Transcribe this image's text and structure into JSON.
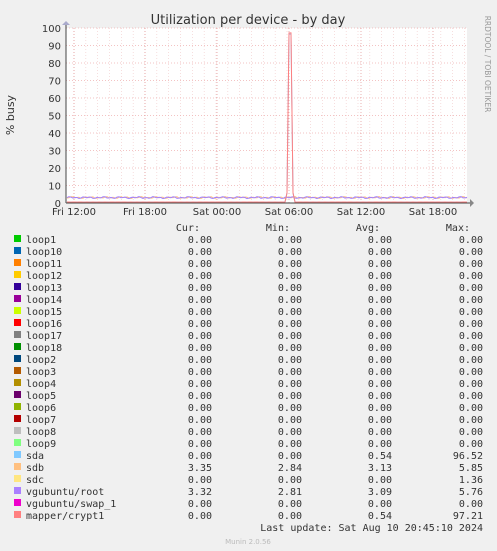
{
  "chart_data": {
    "type": "line",
    "title": "Utilization per device - by day",
    "ylabel": "% busy",
    "watermark": "RRDTOOL / TOBI OETIKER",
    "ylim": [
      0,
      100
    ],
    "yticks": [
      0,
      10,
      20,
      30,
      40,
      50,
      60,
      70,
      80,
      90,
      100
    ],
    "xticks": [
      "Fri 12:00",
      "Fri 18:00",
      "Sat 00:00",
      "Sat 06:00",
      "Sat 12:00",
      "Sat 18:00"
    ],
    "grid": true,
    "series": [
      {
        "name": "sdb",
        "color": "#ffc080",
        "level": 3.13,
        "spike": null
      },
      {
        "name": "vgubuntu/root",
        "color": "#a080ff",
        "level": 3.09,
        "spike": null
      },
      {
        "name": "sda",
        "color": "#80c0ff",
        "level": 0.54,
        "spike": 96.52
      },
      {
        "name": "mapper/crypt1",
        "color": "#ff8080",
        "level": 0.54,
        "spike": 97.21
      }
    ]
  },
  "legend": {
    "headers": {
      "cur": "Cur:",
      "min": "Min:",
      "avg": "Avg:",
      "max": "Max:"
    },
    "rows": [
      {
        "name": "loop1",
        "color": "#00cc00",
        "cur": "0.00",
        "min": "0.00",
        "avg": "0.00",
        "max": "0.00"
      },
      {
        "name": "loop10",
        "color": "#0066b3",
        "cur": "0.00",
        "min": "0.00",
        "avg": "0.00",
        "max": "0.00"
      },
      {
        "name": "loop11",
        "color": "#ff8000",
        "cur": "0.00",
        "min": "0.00",
        "avg": "0.00",
        "max": "0.00"
      },
      {
        "name": "loop12",
        "color": "#ffcc00",
        "cur": "0.00",
        "min": "0.00",
        "avg": "0.00",
        "max": "0.00"
      },
      {
        "name": "loop13",
        "color": "#330099",
        "cur": "0.00",
        "min": "0.00",
        "avg": "0.00",
        "max": "0.00"
      },
      {
        "name": "loop14",
        "color": "#990099",
        "cur": "0.00",
        "min": "0.00",
        "avg": "0.00",
        "max": "0.00"
      },
      {
        "name": "loop15",
        "color": "#ccff00",
        "cur": "0.00",
        "min": "0.00",
        "avg": "0.00",
        "max": "0.00"
      },
      {
        "name": "loop16",
        "color": "#ff0000",
        "cur": "0.00",
        "min": "0.00",
        "avg": "0.00",
        "max": "0.00"
      },
      {
        "name": "loop17",
        "color": "#808080",
        "cur": "0.00",
        "min": "0.00",
        "avg": "0.00",
        "max": "0.00"
      },
      {
        "name": "loop18",
        "color": "#008f00",
        "cur": "0.00",
        "min": "0.00",
        "avg": "0.00",
        "max": "0.00"
      },
      {
        "name": "loop2",
        "color": "#00487d",
        "cur": "0.00",
        "min": "0.00",
        "avg": "0.00",
        "max": "0.00"
      },
      {
        "name": "loop3",
        "color": "#b35a00",
        "cur": "0.00",
        "min": "0.00",
        "avg": "0.00",
        "max": "0.00"
      },
      {
        "name": "loop4",
        "color": "#b38f00",
        "cur": "0.00",
        "min": "0.00",
        "avg": "0.00",
        "max": "0.00"
      },
      {
        "name": "loop5",
        "color": "#6b006b",
        "cur": "0.00",
        "min": "0.00",
        "avg": "0.00",
        "max": "0.00"
      },
      {
        "name": "loop6",
        "color": "#8fb300",
        "cur": "0.00",
        "min": "0.00",
        "avg": "0.00",
        "max": "0.00"
      },
      {
        "name": "loop7",
        "color": "#b30000",
        "cur": "0.00",
        "min": "0.00",
        "avg": "0.00",
        "max": "0.00"
      },
      {
        "name": "loop8",
        "color": "#bebebe",
        "cur": "0.00",
        "min": "0.00",
        "avg": "0.00",
        "max": "0.00"
      },
      {
        "name": "loop9",
        "color": "#80ff80",
        "cur": "0.00",
        "min": "0.00",
        "avg": "0.00",
        "max": "0.00"
      },
      {
        "name": "sda",
        "color": "#80c9ff",
        "cur": "0.00",
        "min": "0.00",
        "avg": "0.54",
        "max": "96.52"
      },
      {
        "name": "sdb",
        "color": "#ffc080",
        "cur": "3.35",
        "min": "2.84",
        "avg": "3.13",
        "max": "5.85"
      },
      {
        "name": "sdc",
        "color": "#ffe680",
        "cur": "0.00",
        "min": "0.00",
        "avg": "0.00",
        "max": "1.36"
      },
      {
        "name": "vgubuntu/root",
        "color": "#aa80ff",
        "cur": "3.32",
        "min": "2.81",
        "avg": "3.09",
        "max": "5.76"
      },
      {
        "name": "vgubuntu/swap_1",
        "color": "#ee00cc",
        "cur": "0.00",
        "min": "0.00",
        "avg": "0.00",
        "max": "0.00"
      },
      {
        "name": "mapper/crypt1",
        "color": "#ff8080",
        "cur": "0.00",
        "min": "0.00",
        "avg": "0.54",
        "max": "97.21"
      }
    ]
  },
  "last_update": "Last update: Sat Aug 10 20:45:10 2024",
  "footer": "Munin 2.0.56"
}
